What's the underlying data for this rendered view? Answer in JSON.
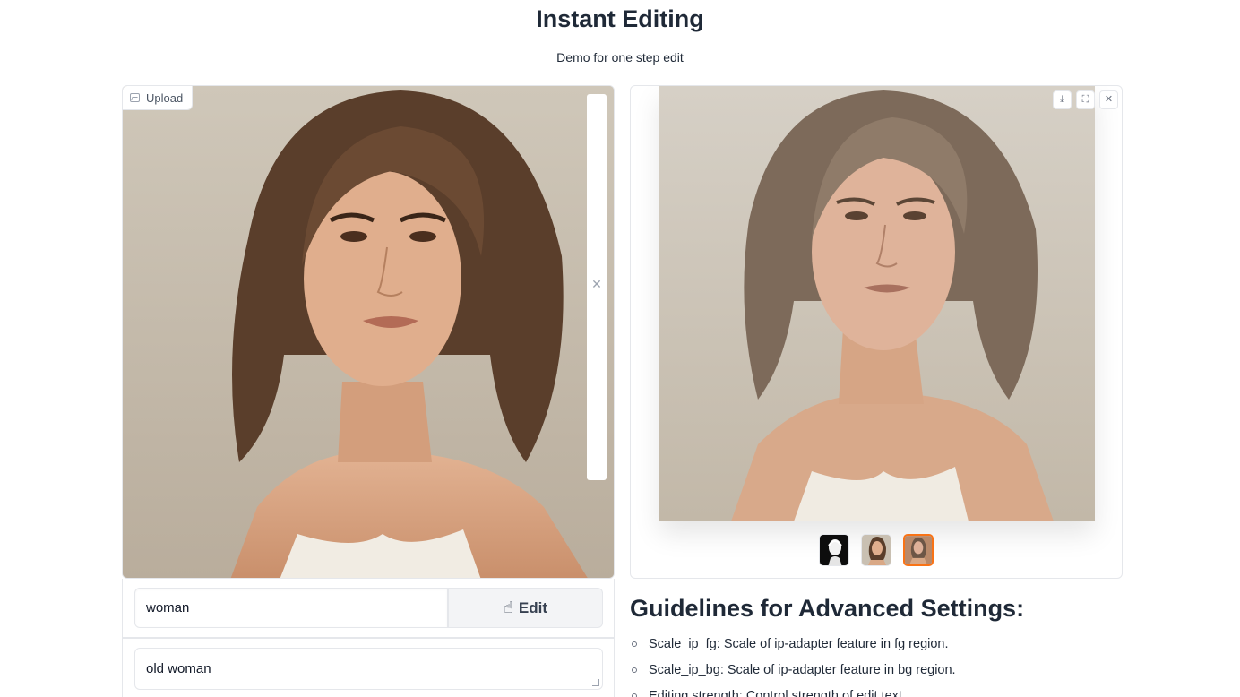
{
  "header": {
    "title": "Instant Editing",
    "subtitle": "Demo for one step edit"
  },
  "input_image": {
    "upload_label": "Upload",
    "clear_icon": "close-icon",
    "image_icon": "image-icon"
  },
  "prompts": {
    "source_value": "woman",
    "edit_button_label": "Edit",
    "target_value": "old woman"
  },
  "gallery": {
    "toolbar_icons": [
      "download-icon",
      "fullscreen-icon",
      "close-icon"
    ],
    "thumbnails": [
      "mask-thumbnail",
      "original-thumbnail",
      "edited-thumbnail"
    ],
    "selected_thumbnail_index": 2
  },
  "guidelines": {
    "title": "Guidelines for Advanced Settings:",
    "items": [
      "Scale_ip_fg: Scale of ip-adapter feature in fg region.",
      "Scale_ip_bg: Scale of ip-adapter feature in bg region.",
      "Editing strength: Control strength of edit text"
    ]
  },
  "colors": {
    "selected_thumb_border": "#f97316",
    "border": "#e5e7eb"
  }
}
